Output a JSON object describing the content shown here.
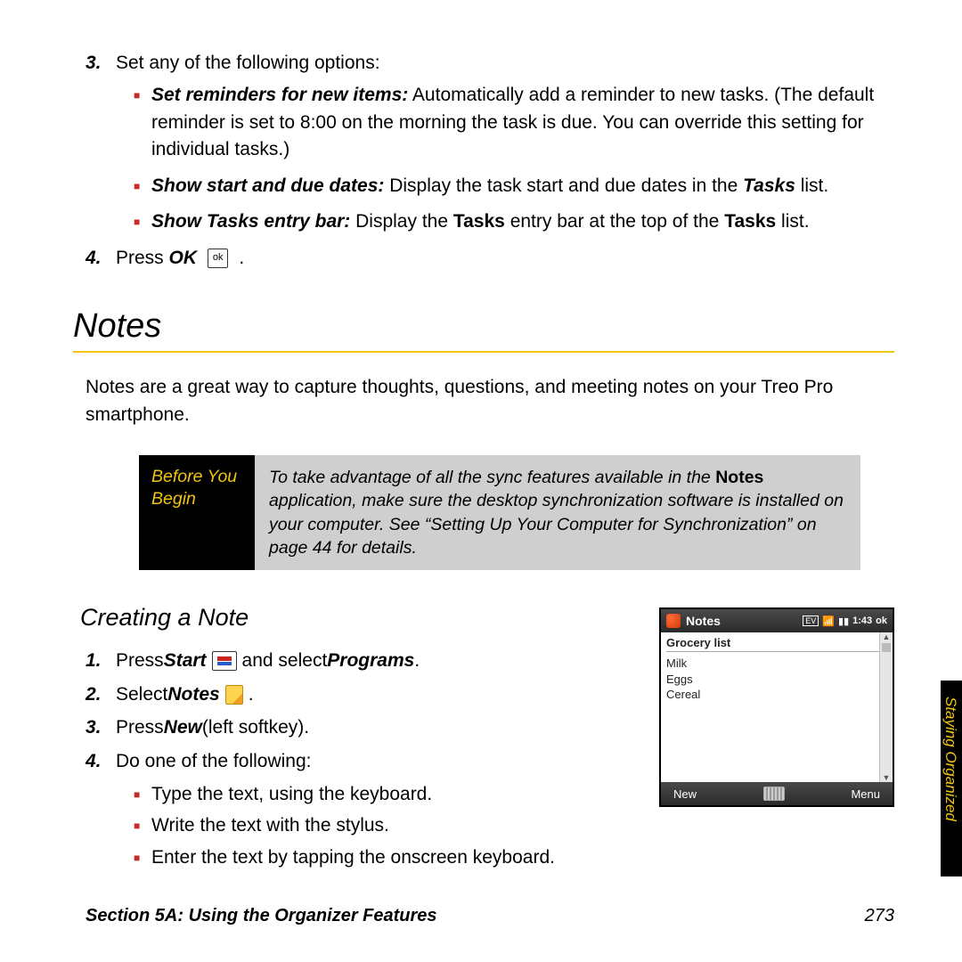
{
  "numbered": {
    "n3": "3.",
    "n3_text": "Set any of the following options:",
    "sub_a_bold": "Set reminders for new items:",
    "sub_a_rest": " Automatically add a reminder to new tasks. (The default reminder is set to 8:00 on the morning the task is due. You can override this setting for individual tasks.)",
    "sub_b_bold": "Show start and due dates:",
    "sub_b_mid": " Display the task start and due dates in the ",
    "sub_b_tasks": "Tasks",
    "sub_b_end": " list.",
    "sub_c_bold": "Show Tasks entry bar:",
    "sub_c_mid": " Display the ",
    "sub_c_tasks1": "Tasks",
    "sub_c_mid2": " entry bar at the top of the ",
    "sub_c_tasks2": "Tasks",
    "sub_c_end": " list.",
    "n4": "4.",
    "n4_press": "Press ",
    "n4_ok": "OK",
    "n4_dot": " ."
  },
  "notes_heading": "Notes",
  "notes_intro": "Notes are a great way to capture thoughts, questions, and meeting notes on your Treo Pro smartphone.",
  "before": {
    "label_l1": "Before You",
    "label_l2": "Begin",
    "text_a": "To take advantage of all the sync features available in the ",
    "text_bold": "Notes",
    "text_b": " application, make sure the desktop synchronization software is installed on your computer. See “Setting Up Your Computer for Synchronization” on page 44 for details."
  },
  "creating_heading": "Creating a Note",
  "create": {
    "n1": "1.",
    "n1_a": "Press ",
    "n1_start": "Start",
    "n1_b": " and select ",
    "n1_programs": "Programs",
    "n1_dot": ".",
    "n2": "2.",
    "n2_a": "Select ",
    "n2_notes": "Notes",
    "n2_dot": " .",
    "n3": "3.",
    "n3_a": "Press ",
    "n3_new": "New",
    "n3_b": " (left softkey).",
    "n4": "4.",
    "n4_text": "Do one of the following:",
    "sub_a": "Type the text, using the keyboard.",
    "sub_b": "Write the text with the stylus.",
    "sub_c": "Enter the text by tapping the onscreen keyboard."
  },
  "device": {
    "title": "Notes",
    "ev": "EV",
    "time": "1:43",
    "ok": "ok",
    "header": "Grocery list",
    "line1": "Milk",
    "line2": "Eggs",
    "line3": "Cereal",
    "soft_left": "New",
    "soft_right": "Menu"
  },
  "side_tab": "Staying Organized",
  "footer_left": "Section 5A: Using the Organizer Features",
  "footer_page": "273",
  "icon_ok_glyph": "ok",
  "chart_data": {
    "type": "table",
    "note": "no chart present"
  }
}
